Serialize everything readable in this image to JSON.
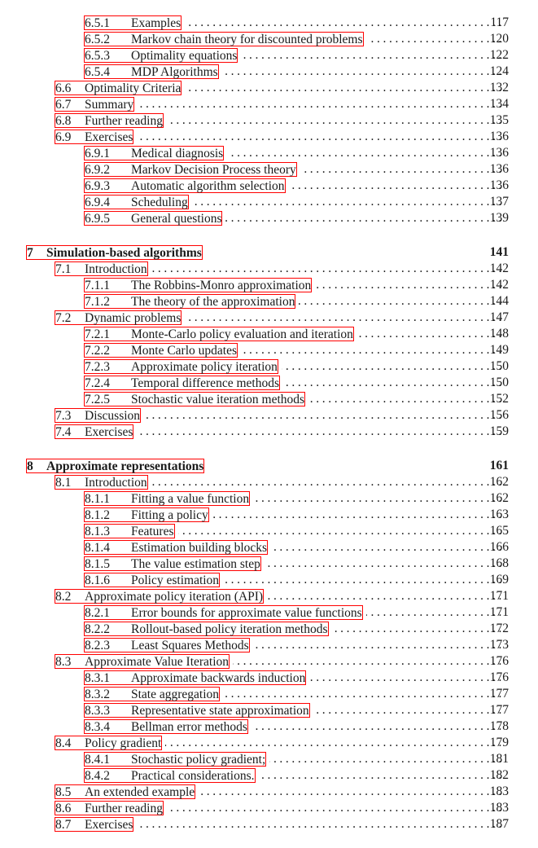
{
  "document": {
    "kind": "table-of-contents",
    "highlight_color": "#ff0000",
    "leader_char": ".",
    "entries": [
      {
        "level": "subsection",
        "number": "6.5.1",
        "title": "Examples",
        "page": "117",
        "leader": true
      },
      {
        "level": "subsection",
        "number": "6.5.2",
        "title": "Markov chain theory for discounted problems",
        "page": "120",
        "leader": true
      },
      {
        "level": "subsection",
        "number": "6.5.3",
        "title": "Optimality equations",
        "page": "122",
        "leader": true
      },
      {
        "level": "subsection",
        "number": "6.5.4",
        "title": "MDP Algorithms",
        "page": "124",
        "leader": true
      },
      {
        "level": "section",
        "number": "6.6",
        "title": "Optimality Criteria",
        "page": "132",
        "leader": true
      },
      {
        "level": "section",
        "number": "6.7",
        "title": "Summary",
        "page": "134",
        "leader": true
      },
      {
        "level": "section",
        "number": "6.8",
        "title": "Further reading",
        "page": "135",
        "leader": true
      },
      {
        "level": "section",
        "number": "6.9",
        "title": "Exercises",
        "page": "136",
        "leader": true
      },
      {
        "level": "subsection",
        "number": "6.9.1",
        "title": "Medical diagnosis",
        "page": "136",
        "leader": true
      },
      {
        "level": "subsection",
        "number": "6.9.2",
        "title": "Markov Decision Process theory",
        "page": "136",
        "leader": true
      },
      {
        "level": "subsection",
        "number": "6.9.3",
        "title": "Automatic algorithm selection",
        "page": "136",
        "leader": true
      },
      {
        "level": "subsection",
        "number": "6.9.4",
        "title": "Scheduling",
        "page": "137",
        "leader": true
      },
      {
        "level": "subsection",
        "number": "6.9.5",
        "title": "General questions",
        "page": "139",
        "leader": true
      },
      {
        "level": "chapter",
        "number": "7",
        "title": "Simulation-based algorithms",
        "page": "141",
        "leader": false,
        "gap_before": true
      },
      {
        "level": "section",
        "number": "7.1",
        "title": "Introduction",
        "page": "142",
        "leader": true
      },
      {
        "level": "subsection",
        "number": "7.1.1",
        "title": "The Robbins-Monro approximation",
        "page": "142",
        "leader": true
      },
      {
        "level": "subsection",
        "number": "7.1.2",
        "title": "The theory of the approximation",
        "page": "144",
        "leader": true
      },
      {
        "level": "section",
        "number": "7.2",
        "title": "Dynamic problems",
        "page": "147",
        "leader": true
      },
      {
        "level": "subsection",
        "number": "7.2.1",
        "title": "Monte-Carlo policy evaluation and iteration",
        "page": "148",
        "leader": true
      },
      {
        "level": "subsection",
        "number": "7.2.2",
        "title": "Monte Carlo updates",
        "page": "149",
        "leader": true
      },
      {
        "level": "subsection",
        "number": "7.2.3",
        "title": "Approximate policy iteration",
        "page": "150",
        "leader": true
      },
      {
        "level": "subsection",
        "number": "7.2.4",
        "title": "Temporal difference methods",
        "page": "150",
        "leader": true
      },
      {
        "level": "subsection",
        "number": "7.2.5",
        "title": "Stochastic value iteration methods",
        "page": "152",
        "leader": true
      },
      {
        "level": "section",
        "number": "7.3",
        "title": "Discussion",
        "page": "156",
        "leader": true
      },
      {
        "level": "section",
        "number": "7.4",
        "title": "Exercises",
        "page": "159",
        "leader": true
      },
      {
        "level": "chapter",
        "number": "8",
        "title": "Approximate representations",
        "page": "161",
        "leader": false,
        "gap_before": true
      },
      {
        "level": "section",
        "number": "8.1",
        "title": "Introduction",
        "page": "162",
        "leader": true
      },
      {
        "level": "subsection",
        "number": "8.1.1",
        "title": "Fitting a value function",
        "page": "162",
        "leader": true
      },
      {
        "level": "subsection",
        "number": "8.1.2",
        "title": "Fitting a policy",
        "page": "163",
        "leader": true
      },
      {
        "level": "subsection",
        "number": "8.1.3",
        "title": "Features",
        "page": "165",
        "leader": true
      },
      {
        "level": "subsection",
        "number": "8.1.4",
        "title": "Estimation building blocks",
        "page": "166",
        "leader": true
      },
      {
        "level": "subsection",
        "number": "8.1.5",
        "title": "The value estimation step",
        "page": "168",
        "leader": true
      },
      {
        "level": "subsection",
        "number": "8.1.6",
        "title": "Policy estimation",
        "page": "169",
        "leader": true
      },
      {
        "level": "section",
        "number": "8.2",
        "title": "Approximate policy iteration (API)",
        "page": "171",
        "leader": true
      },
      {
        "level": "subsection",
        "number": "8.2.1",
        "title": "Error bounds for approximate value functions",
        "page": "171",
        "leader": true
      },
      {
        "level": "subsection",
        "number": "8.2.2",
        "title": "Rollout-based policy iteration methods",
        "page": "172",
        "leader": true
      },
      {
        "level": "subsection",
        "number": "8.2.3",
        "title": "Least Squares Methods",
        "page": "173",
        "leader": true
      },
      {
        "level": "section",
        "number": "8.3",
        "title": "Approximate Value Iteration",
        "page": "176",
        "leader": true
      },
      {
        "level": "subsection",
        "number": "8.3.1",
        "title": "Approximate backwards induction",
        "page": "176",
        "leader": true
      },
      {
        "level": "subsection",
        "number": "8.3.2",
        "title": "State aggregation",
        "page": "177",
        "leader": true
      },
      {
        "level": "subsection",
        "number": "8.3.3",
        "title": "Representative state approximation",
        "page": "177",
        "leader": true
      },
      {
        "level": "subsection",
        "number": "8.3.4",
        "title": "Bellman error methods",
        "page": "178",
        "leader": true
      },
      {
        "level": "section",
        "number": "8.4",
        "title": "Policy gradient",
        "page": "179",
        "leader": true
      },
      {
        "level": "subsection",
        "number": "8.4.1",
        "title": "Stochastic policy gradient;",
        "page": "181",
        "leader": true
      },
      {
        "level": "subsection",
        "number": "8.4.2",
        "title": "Practical considerations.",
        "page": "182",
        "leader": true
      },
      {
        "level": "section",
        "number": "8.5",
        "title": "An extended example",
        "page": "183",
        "leader": true
      },
      {
        "level": "section",
        "number": "8.6",
        "title": "Further reading",
        "page": "183",
        "leader": true
      },
      {
        "level": "section",
        "number": "8.7",
        "title": "Exercises",
        "page": "187",
        "leader": true
      }
    ]
  }
}
